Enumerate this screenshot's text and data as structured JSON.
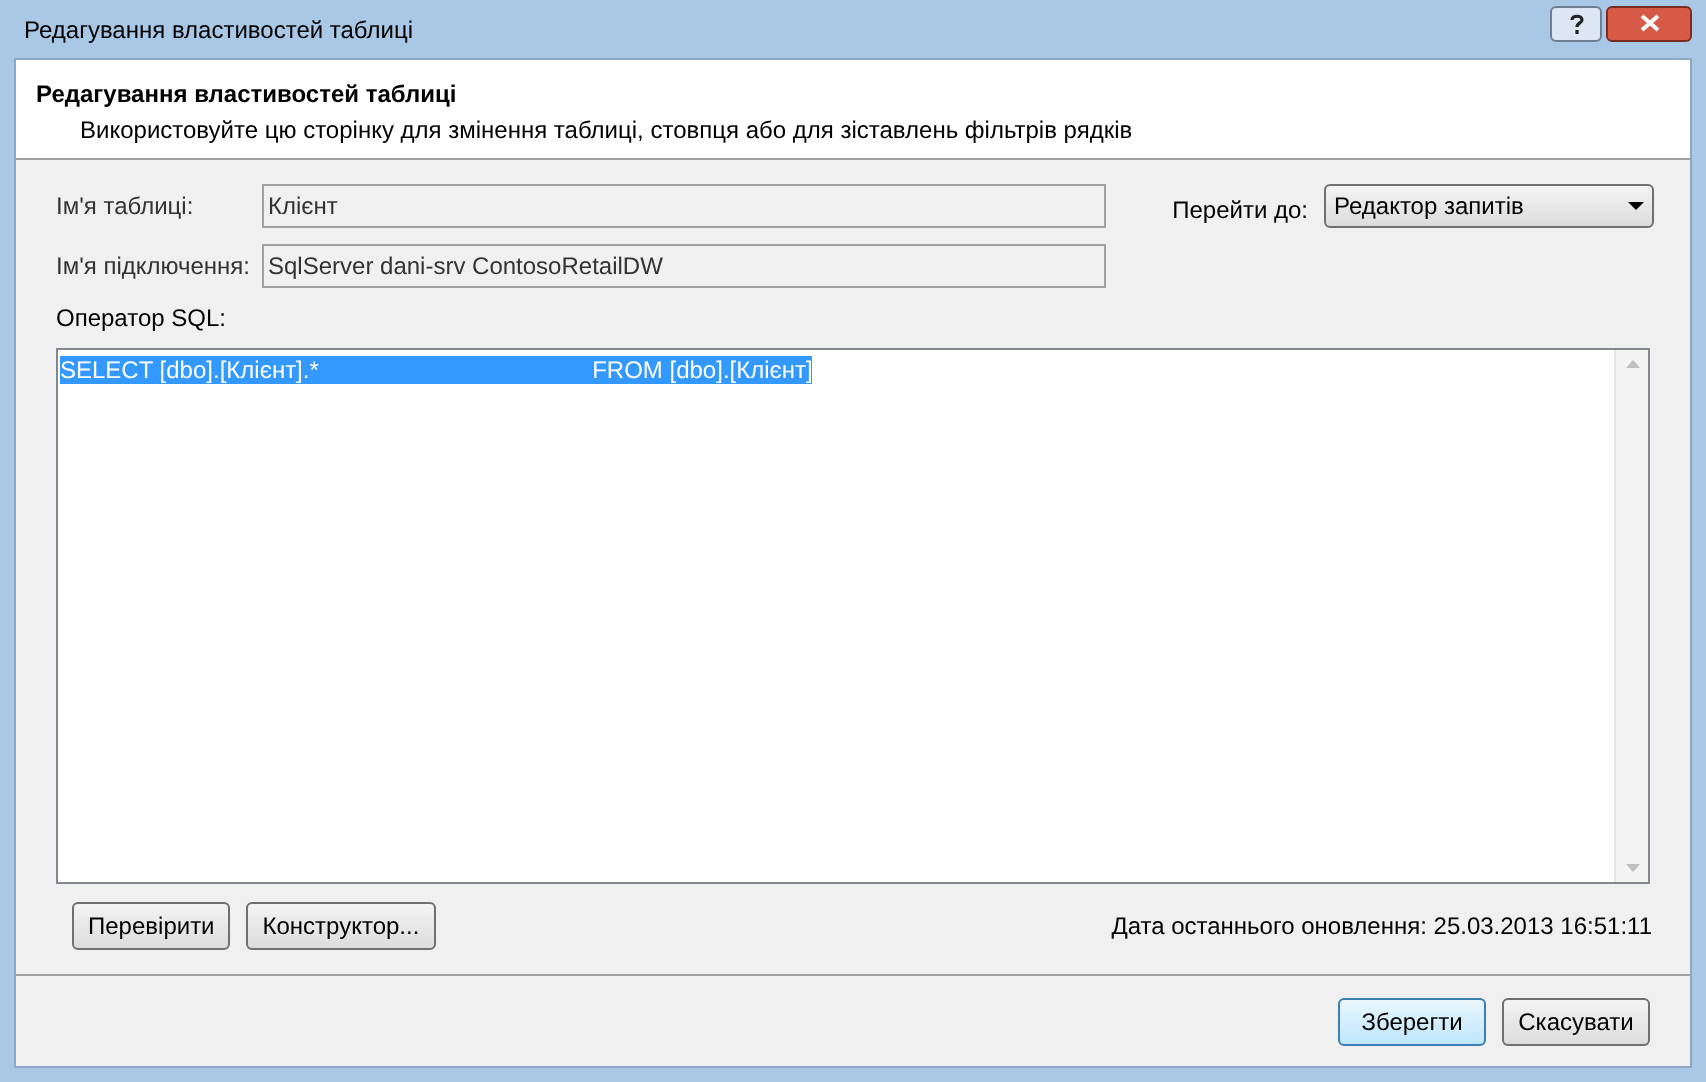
{
  "window": {
    "title": "Редагування властивостей таблиці"
  },
  "header": {
    "title": "Редагування властивостей таблиці",
    "description": "Використовуйте цю сторінку для змінення таблиці, стовпця або для зіставлень фільтрів рядків"
  },
  "fields": [
    {
      "label": "Ім'я таблиці:",
      "value": "Клієнт"
    },
    {
      "label": "Ім'я підключення:",
      "value": "SqlServer dani-srv ContosoRetailDW"
    }
  ],
  "goto": {
    "label": "Перейти до:",
    "value": "Редактор запитів"
  },
  "sql": {
    "label": "Оператор SQL:",
    "text": "SELECT [dbo].[Клієнт].*                                         FROM [dbo].[Клієнт]",
    "selected": true
  },
  "tool_buttons": [
    "Перевірити",
    "Конструктор..."
  ],
  "last_updated": "Дата останнього оновлення: 25.03.2013 16:51:11",
  "buttons": [
    {
      "label": "Зберегти",
      "default": true
    },
    {
      "label": "Скасувати",
      "default": false
    }
  ]
}
